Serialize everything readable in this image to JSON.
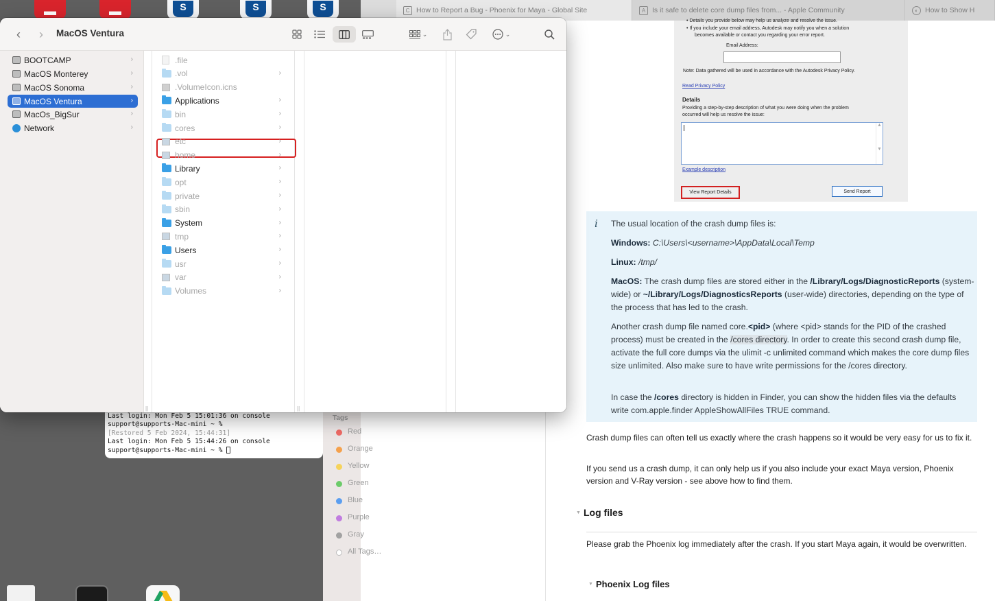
{
  "browser": {
    "tabs": [
      {
        "label": "How to Report a Bug - Phoenix for Maya - Global Site",
        "icon": "c-logo-icon"
      },
      {
        "label": "Is it safe to delete core dump files from... - Apple Community",
        "icon": "apple-community-icon"
      },
      {
        "label": "How to Show H",
        "icon": "site-icon"
      }
    ],
    "report_form": {
      "line1": "• Details you provide below may help us analyze and resolve the issue.",
      "line2": "• If you include your email address, Autodesk may notify you when a solution",
      "line3": "becomes available or contact you regarding your error report.",
      "email_label": "Email Address:",
      "note": "Note: Data gathered will be used in accordance with the Autodesk Privacy Policy.",
      "privacy_link": "Read Privacy Policy",
      "details_title": "Details",
      "details_desc1": "Providing a step-by-step description of what you were doing when the problem",
      "details_desc2": "occurred will help us resolve the issue:",
      "example_link": "Example description",
      "view_report_btn": "View Report Details",
      "send_report_btn": "Send Report"
    },
    "info": {
      "intro": "The usual location of the crash dump files is:",
      "windows_label": "Windows:",
      "windows_path": "C:\\Users\\<username>\\AppData\\Local\\Temp",
      "linux_label": "Linux:",
      "linux_path": "/tmp/",
      "macos_label": "MacOS:",
      "macos_text_a": "The crash dump files are stored either in the",
      "macos_path1": "/Library/Logs/DiagnosticReports",
      "macos_text_b": "(system-wide) or",
      "macos_path2": "~/Library/Logs/DiagnosticsReports",
      "macos_text_c": "(user-wide) directories, depending on the type of the process that has led to the crash.",
      "core_a": "Another crash dump file named core.",
      "core_pid": "<pid>",
      "core_b": "(where <pid> stands for the PID of the crashed process) must be created in the",
      "core_dir": "/cores directory",
      "core_c": ". In order to create this second crash dump file, activate the full core dumps via the ulimit -c unlimited command which makes the core dump files size unlimited. Also make sure to have write permissions for the /cores directory.",
      "hidden_a": "In case the",
      "hidden_cores": "/cores",
      "hidden_b": "directory is hidden in Finder, you can show the hidden files via the defaults write com.apple.finder AppleShowAllFiles TRUE command."
    },
    "para1": "Crash dump files can often tell us exactly where the crash happens so it would be very easy for us to fix it.",
    "para2": "If you send us a crash dump, it can only help us if you also include your exact Maya version, Phoenix version and V-Ray version - see above how to find them.",
    "log_heading": "Log files",
    "log_para": "Please grab the Phoenix log immediately after the crash. If you start Maya again, it would be overwritten.",
    "phoenix_log_heading": "Phoenix Log files"
  },
  "terminal": {
    "lines": [
      "Last login: Mon Feb  5 15:01:36 on console",
      "support@supports-Mac-mini ~ %",
      "  [Restored 5 Feb 2024, 15:44:31]",
      "Last login: Mon Feb  5 15:44:26 on console",
      "support@supports-Mac-mini ~ %"
    ]
  },
  "tags": {
    "title": "Tags",
    "items": [
      {
        "label": "Red",
        "color": "#f06b66"
      },
      {
        "label": "Orange",
        "color": "#f5a14c"
      },
      {
        "label": "Yellow",
        "color": "#f6d35b"
      },
      {
        "label": "Green",
        "color": "#6ccb6a"
      },
      {
        "label": "Blue",
        "color": "#5b9ef0"
      },
      {
        "label": "Purple",
        "color": "#c17de0"
      },
      {
        "label": "Gray",
        "color": "#a2a2a2"
      },
      {
        "label": "All Tags…",
        "color": "#ffffff"
      }
    ]
  },
  "finder": {
    "title": "MacOS Ventura",
    "sidebar": [
      {
        "label": "BOOTCAMP",
        "icon": "disk-icon"
      },
      {
        "label": "MacOS Monterey",
        "icon": "disk-icon"
      },
      {
        "label": "MacOS Sonoma",
        "icon": "disk-icon"
      },
      {
        "label": "MacOS Ventura",
        "icon": "disk-icon",
        "selected": true
      },
      {
        "label": "MacOs_BigSur",
        "icon": "disk-icon"
      },
      {
        "label": "Network",
        "icon": "globe-icon"
      }
    ],
    "files": [
      {
        "label": ".file",
        "kind": "doc",
        "hidden": true,
        "chev": false
      },
      {
        "label": ".vol",
        "kind": "folder",
        "hidden": true,
        "chev": true
      },
      {
        "label": ".VolumeIcon.icns",
        "kind": "image",
        "hidden": true,
        "chev": false
      },
      {
        "label": "Applications",
        "kind": "folder",
        "hidden": false,
        "chev": true
      },
      {
        "label": "bin",
        "kind": "folder",
        "hidden": true,
        "chev": true
      },
      {
        "label": "cores",
        "kind": "folder",
        "hidden": true,
        "chev": true
      },
      {
        "label": "etc",
        "kind": "alias",
        "hidden": true,
        "chev": true
      },
      {
        "label": "home",
        "kind": "alias",
        "hidden": true,
        "chev": true
      },
      {
        "label": "Library",
        "kind": "folder",
        "hidden": false,
        "chev": true
      },
      {
        "label": "opt",
        "kind": "folder",
        "hidden": true,
        "chev": true
      },
      {
        "label": "private",
        "kind": "folder",
        "hidden": true,
        "chev": true
      },
      {
        "label": "sbin",
        "kind": "folder",
        "hidden": true,
        "chev": true
      },
      {
        "label": "System",
        "kind": "folder",
        "hidden": false,
        "chev": true
      },
      {
        "label": "tmp",
        "kind": "alias",
        "hidden": true,
        "chev": true
      },
      {
        "label": "Users",
        "kind": "folder",
        "hidden": false,
        "chev": true
      },
      {
        "label": "usr",
        "kind": "folder",
        "hidden": true,
        "chev": true
      },
      {
        "label": "var",
        "kind": "alias",
        "hidden": true,
        "chev": true
      },
      {
        "label": "Volumes",
        "kind": "folder",
        "hidden": true,
        "chev": true
      }
    ]
  }
}
